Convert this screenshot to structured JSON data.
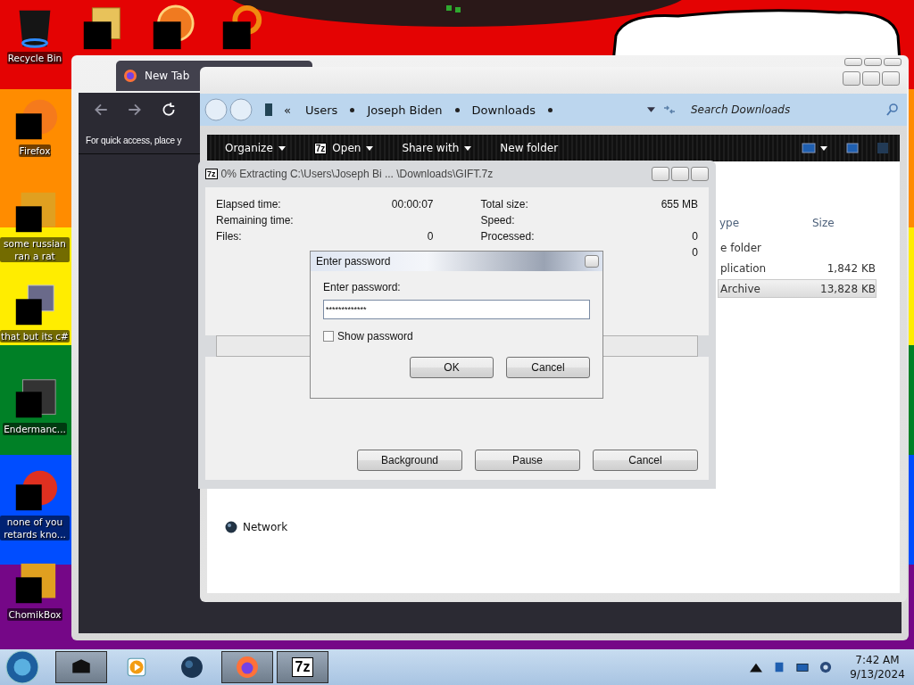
{
  "desktop": {
    "icons": [
      {
        "kind": "bin",
        "label": "Recycle Bin"
      },
      {
        "kind": "fox",
        "label": "Firefox"
      },
      {
        "kind": "square",
        "label": "some russian ran a rat"
      },
      {
        "kind": "stack",
        "label": "that but its c#"
      },
      {
        "kind": "list",
        "label": "Endermanc..."
      },
      {
        "kind": "circle",
        "label": "none of you retards kno..."
      },
      {
        "kind": "square",
        "label": "ChomikBox"
      }
    ],
    "top_icons": [
      {
        "kind": "stack"
      },
      {
        "kind": "circle"
      },
      {
        "kind": "ring"
      }
    ]
  },
  "browser": {
    "tab": {
      "label": "New Tab",
      "selected": true
    },
    "bookmarks_hint": "For quick access, place y"
  },
  "explorer": {
    "overflow": "«",
    "breadcrumb": [
      "Users",
      "Joseph Biden",
      "Downloads"
    ],
    "search": {
      "placeholder": "Search Downloads"
    },
    "toolbar": [
      {
        "label": "Organize",
        "dropdown": true
      },
      {
        "label": "Open",
        "icon_text": "7z",
        "dropdown": true
      },
      {
        "label": "Share with",
        "dropdown": true
      },
      {
        "label": "New folder",
        "dropdown": false
      }
    ],
    "columns": [
      "ype",
      "Size"
    ],
    "rows": [
      {
        "type": "e folder",
        "selected": false
      },
      {
        "type": "plication",
        "size": "1,842 KB",
        "selected": false
      },
      {
        "type": "Archive",
        "size": "13,828 KB",
        "selected": true
      }
    ],
    "nav": [
      {
        "label": "Network"
      }
    ]
  },
  "progress": {
    "icon_text": "7z",
    "title": "0% Extracting C:\\Users\\Joseph Bi ... \\Downloads\\GIFT.7z",
    "left": [
      {
        "label": "Elapsed time:",
        "value": "00:00:07"
      },
      {
        "label": "Remaining time:"
      },
      {
        "label": "Files:",
        "value": "0"
      }
    ],
    "right": [
      {
        "label": "Total size:",
        "value": "655 MB"
      },
      {
        "label": "Speed:"
      },
      {
        "label": "Processed:",
        "value": "0"
      },
      {
        "value": "0"
      }
    ],
    "level": 0,
    "buttons": [
      "Background",
      "Pause",
      "Cancel"
    ]
  },
  "password": {
    "title": "Enter password",
    "label": "Enter password:",
    "value": "*************",
    "show_password": {
      "label": "Show password",
      "checked": false
    },
    "buttons": [
      "OK",
      "Cancel"
    ]
  },
  "taskbar": {
    "items": [
      {
        "kind": "device",
        "running": true
      },
      {
        "kind": "media",
        "running": false
      },
      {
        "kind": "globe",
        "running": false
      },
      {
        "kind": "fox",
        "running": true
      },
      {
        "kind": "sevenzip",
        "icon_text": "7z",
        "running": true
      }
    ],
    "time": "7:42 AM",
    "date": "9/13/2024"
  }
}
